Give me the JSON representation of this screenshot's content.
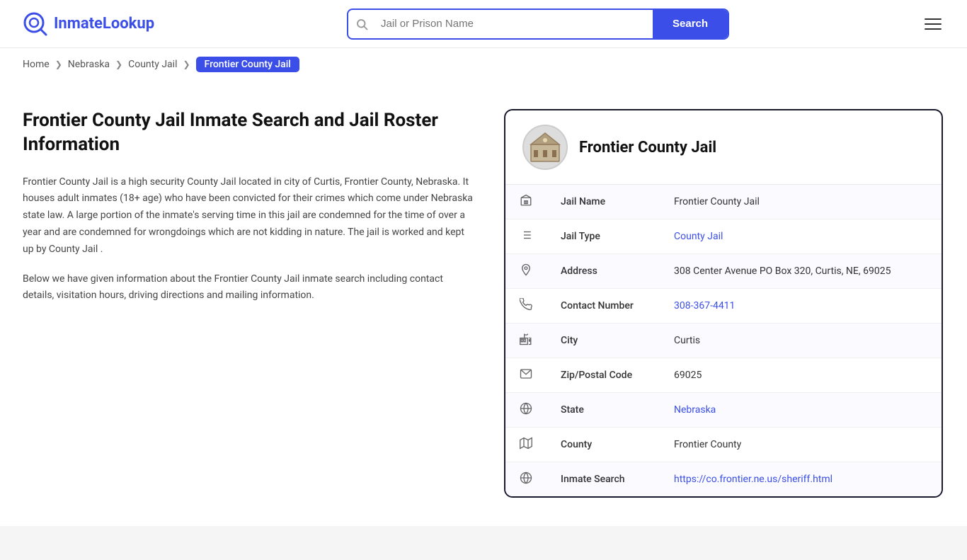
{
  "header": {
    "logo_brand": "InmateLookup",
    "logo_brand_first": "Inmate",
    "logo_brand_second": "Lookup",
    "search_placeholder": "Jail or Prison Name",
    "search_button_label": "Search",
    "menu_label": "Menu"
  },
  "breadcrumb": {
    "home": "Home",
    "state": "Nebraska",
    "type": "County Jail",
    "current": "Frontier County Jail"
  },
  "left": {
    "page_title": "Frontier County Jail Inmate Search and Jail Roster Information",
    "description1": "Frontier County Jail is a high security County Jail located in city of Curtis, Frontier County, Nebraska. It houses adult inmates (18+ age) who have been convicted for their crimes which come under Nebraska state law. A large portion of the inmate's serving time in this jail are condemned for the time of over a year and are condemned for wrongdoings which are not kidding in nature. The jail is worked and kept up by County Jail .",
    "description2": "Below we have given information about the Frontier County Jail inmate search including contact details, visitation hours, driving directions and mailing information."
  },
  "card": {
    "title": "Frontier County Jail",
    "fields": [
      {
        "label": "Jail Name",
        "value": "Frontier County Jail",
        "link": null,
        "icon": "building"
      },
      {
        "label": "Jail Type",
        "value": "County Jail",
        "link": "#",
        "icon": "list"
      },
      {
        "label": "Address",
        "value": "308 Center Avenue PO Box 320, Curtis, NE, 69025",
        "link": null,
        "icon": "pin"
      },
      {
        "label": "Contact Number",
        "value": "308-367-4411",
        "link": "tel:308-367-4411",
        "icon": "phone"
      },
      {
        "label": "City",
        "value": "Curtis",
        "link": null,
        "icon": "city"
      },
      {
        "label": "Zip/Postal Code",
        "value": "69025",
        "link": null,
        "icon": "mail"
      },
      {
        "label": "State",
        "value": "Nebraska",
        "link": "#",
        "icon": "globe"
      },
      {
        "label": "County",
        "value": "Frontier County",
        "link": null,
        "icon": "map"
      },
      {
        "label": "Inmate Search",
        "value": "https://co.frontier.ne.us/sheriff.html",
        "link": "https://co.frontier.ne.us/sheriff.html",
        "icon": "globe2"
      }
    ]
  }
}
